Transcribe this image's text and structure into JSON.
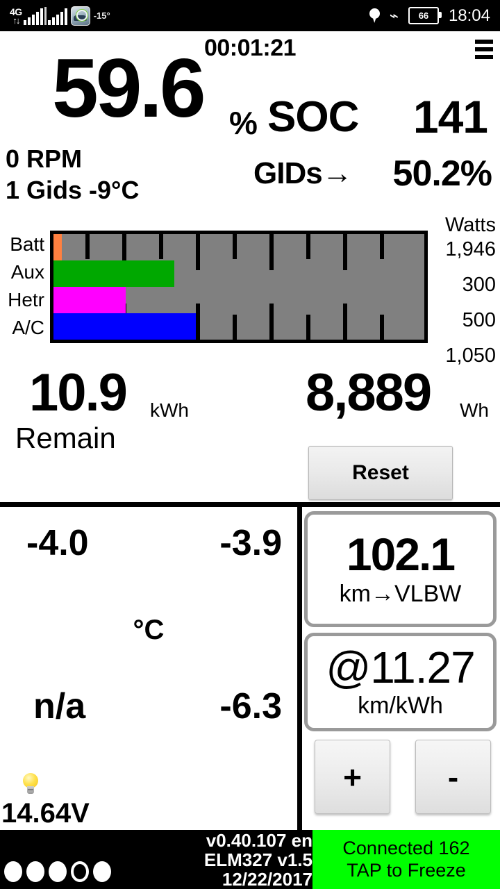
{
  "statusbar": {
    "network_label": "4G",
    "network_arrows": "↑↓",
    "ext_temp": "-15°",
    "battery_pct": "66",
    "clock": "18:04",
    "icons": {
      "location": "location-pin-icon",
      "bluetooth": "bluetooth-icon",
      "battery": "battery-icon",
      "app": "leafspy-app-icon"
    }
  },
  "header": {
    "timer": "00:01:21",
    "menu": "menu-icon"
  },
  "soc": {
    "value": "59.6",
    "percent_symbol": "%",
    "label": "SOC",
    "gids_count": "141"
  },
  "secondary": {
    "rpm": "0 RPM",
    "gids_line": "1 Gids -9°C",
    "gids_arrow_label": "GIDs→",
    "gids_percent": "50.2%"
  },
  "chart_data": {
    "type": "bar",
    "title": "",
    "xlabel": "",
    "ylabel": "",
    "unit_header": "Watts",
    "orientation": "horizontal",
    "categories": [
      "Batt",
      "Aux",
      "Hetr",
      "A/C"
    ],
    "values": [
      1946,
      300,
      500,
      1050
    ],
    "value_labels": [
      "1,946",
      "300",
      "500",
      "1,050"
    ],
    "bar_colors": [
      "#FF8040",
      "#00A800",
      "#FF00FF",
      "#0000FF"
    ],
    "bar_fractions": [
      0.022,
      0.325,
      0.195,
      0.383
    ],
    "track_color": "#808080",
    "border_color": "#000000",
    "tick_count": 10,
    "grid": true,
    "legend": "none",
    "xlim": [
      0,
      10000
    ]
  },
  "energy": {
    "remain_value": "10.9",
    "remain_unit": "kWh",
    "remain_label": "Remain",
    "trip_value": "8,889",
    "trip_unit": "Wh",
    "reset_label": "Reset"
  },
  "temps": {
    "top_left": "-4.0",
    "top_right": "-3.9",
    "unit": "°C",
    "bottom_left": "n/a",
    "bottom_right": "-6.3",
    "bulb_icon": "lightbulb-icon",
    "voltage": "14.64V"
  },
  "rangecards": {
    "range_value": "102.1",
    "range_unit": "km→VLBW",
    "efficiency_value": "@11.27",
    "efficiency_unit": "km/kWh",
    "plus_label": "+",
    "minus_label": "-"
  },
  "bottombar": {
    "dots": [
      "filled",
      "filled",
      "filled",
      "hollow",
      "filled"
    ],
    "version": "v0.40.107 en",
    "adapter": "ELM327 v1.5",
    "date": "12/22/2017",
    "connection_line1": "Connected 162",
    "connection_line2": "TAP to Freeze",
    "connection_color": "#00ff00"
  }
}
